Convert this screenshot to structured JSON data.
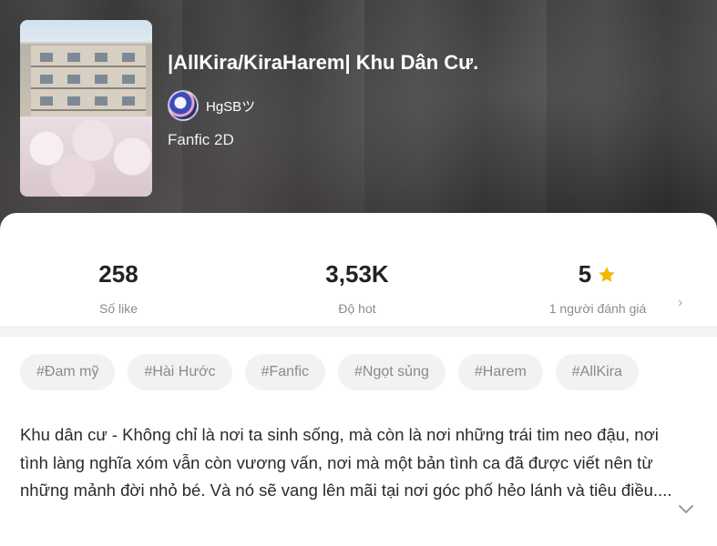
{
  "story": {
    "title": "|AllKira/KiraHarem| Khu Dân Cư.",
    "author": "HgSBツ",
    "genre": "Fanfic 2D"
  },
  "stats": {
    "likes": {
      "value": "258",
      "label": "Số like"
    },
    "hot": {
      "value": "3,53K",
      "label": "Độ hot"
    },
    "rating": {
      "value": "5",
      "label": "1 người đánh giá",
      "icon": "star-icon",
      "icon_color": "#f5b800"
    }
  },
  "tags": [
    "#Đam mỹ",
    "#Hài Hước",
    "#Fanfic",
    "#Ngọt sủng",
    "#Harem",
    "#AllKira"
  ],
  "description": "Khu dân cư - Không chỉ là nơi ta sinh sống, mà còn là nơi những trái tim neo đậu, nơi tình làng nghĩa xóm vẫn còn vương vấn, nơi mà một bản tình ca đã được viết nên từ những mảnh đời nhỏ bé. Và nó sẽ vang lên mãi tại nơi góc phố hẻo lánh và tiêu điều....",
  "icons": {
    "rating_more": "chevron-right-icon",
    "expand": "chevron-down-icon"
  }
}
